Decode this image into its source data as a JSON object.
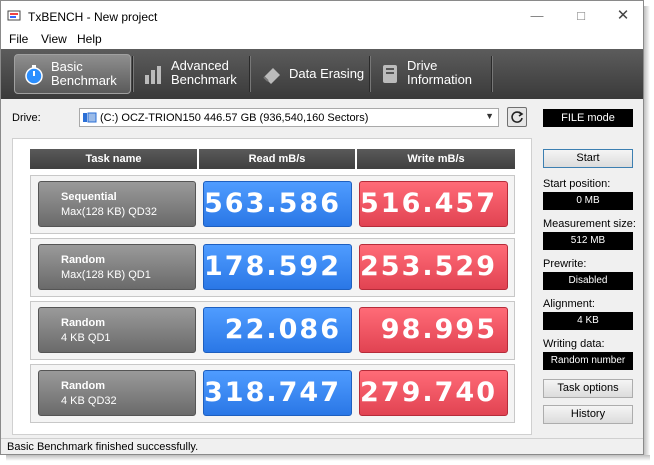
{
  "window": {
    "title": "TxBENCH - New project"
  },
  "menu": [
    "File",
    "View",
    "Help"
  ],
  "tabs": [
    {
      "line1": "Basic",
      "line2": "Benchmark",
      "selected": true
    },
    {
      "line1": "Advanced",
      "line2": "Benchmark",
      "selected": false
    },
    {
      "line1": "Data Erasing",
      "line2": "",
      "selected": false
    },
    {
      "line1": "Drive",
      "line2": "Information",
      "selected": false
    }
  ],
  "drive": {
    "label": "Drive:",
    "value": "(C:) OCZ-TRION150   446.57 GB (936,540,160 Sectors)"
  },
  "mode": "FILE mode",
  "table": {
    "headers": [
      "Task name",
      "Read mB/s",
      "Write mB/s"
    ],
    "rows": [
      {
        "name": "Sequential",
        "detail": "Max(128 KB) QD32",
        "read": "563.586",
        "write": "516.457"
      },
      {
        "name": "Random",
        "detail": "Max(128 KB) QD1",
        "read": "178.592",
        "write": "253.529"
      },
      {
        "name": "Random",
        "detail": "4 KB QD1",
        "read": "22.086",
        "write": "98.995"
      },
      {
        "name": "Random",
        "detail": "4 KB QD32",
        "read": "318.747",
        "write": "279.740"
      }
    ]
  },
  "side": {
    "start": "Start",
    "start_position_label": "Start position:",
    "start_position": "0 MB",
    "measurement_label": "Measurement size:",
    "measurement": "512 MB",
    "prewrite_label": "Prewrite:",
    "prewrite": "Disabled",
    "alignment_label": "Alignment:",
    "alignment": "4 KB",
    "writing_label": "Writing data:",
    "writing": "Random number",
    "task_options": "Task options",
    "history": "History"
  },
  "status": "Basic Benchmark finished successfully.",
  "colors": {
    "read": "#2f7fef",
    "write": "#e8505e",
    "toolbar": "#4a4a4a"
  }
}
